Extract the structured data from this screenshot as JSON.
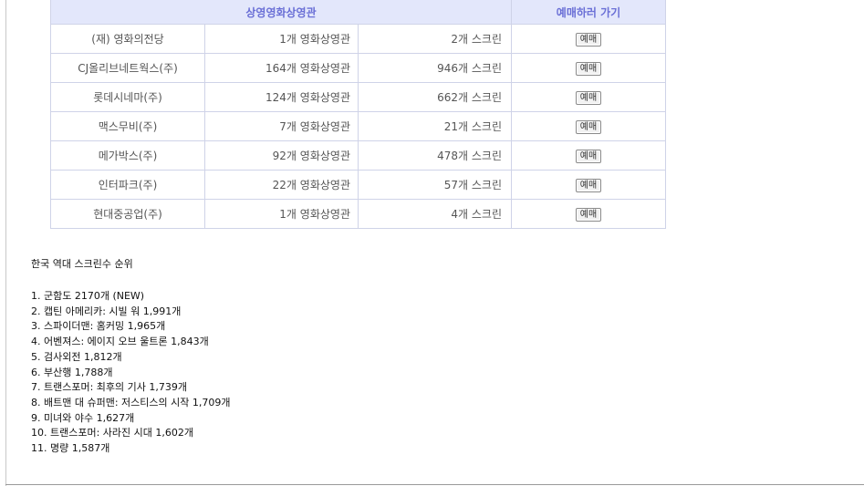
{
  "table": {
    "header_theaters": "상영영화상영관",
    "header_action": "예매하러 가기",
    "rows": [
      {
        "name": "(재) 영화의전당",
        "theaters": "1개 영화상영관",
        "screens": "2개 스크린",
        "button": "예매"
      },
      {
        "name": "CJ올리브네트웍스(주)",
        "theaters": "164개 영화상영관",
        "screens": "946개 스크린",
        "button": "예매"
      },
      {
        "name": "롯데시네마(주)",
        "theaters": "124개 영화상영관",
        "screens": "662개 스크린",
        "button": "예매"
      },
      {
        "name": "맥스무비(주)",
        "theaters": "7개 영화상영관",
        "screens": "21개 스크린",
        "button": "예매"
      },
      {
        "name": "메가박스(주)",
        "theaters": "92개 영화상영관",
        "screens": "478개 스크린",
        "button": "예매"
      },
      {
        "name": "인터파크(주)",
        "theaters": "22개 영화상영관",
        "screens": "57개 스크린",
        "button": "예매"
      },
      {
        "name": "현대중공업(주)",
        "theaters": "1개 영화상영관",
        "screens": "4개 스크린",
        "button": "예매"
      }
    ]
  },
  "ranking": {
    "title": "한국 역대 스크린수 순위",
    "items": [
      "1. 군함도 2170개 (NEW)",
      "2. 캡틴 아메리카: 시빌 워 1,991개",
      "3. 스파이더맨: 홈커밍 1,965개",
      "4. 어벤져스: 에이지 오브 울트론 1,843개",
      "5. 검사외전 1,812개",
      "6. 부산행 1,788개",
      "7. 트랜스포머: 최후의 기사 1,739개",
      "8. 배트맨 대 슈퍼맨: 저스티스의 시작 1,709개",
      "9. 미녀와 야수 1,627개",
      "10. 트랜스포머: 사라진 시대 1,602개",
      "11. 명량 1,587개"
    ]
  }
}
